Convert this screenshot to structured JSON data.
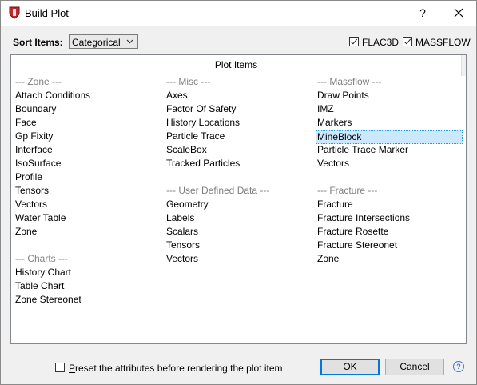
{
  "window": {
    "title": "Build Plot",
    "help_label": "?"
  },
  "sort": {
    "label": "Sort Items:",
    "selected": "Categorical"
  },
  "filters": [
    {
      "label": "FLAC3D",
      "checked": true
    },
    {
      "label": "MASSFLOW",
      "checked": true
    }
  ],
  "list": {
    "header": "Plot Items",
    "columns": [
      {
        "groups": [
          {
            "category": "--- Zone ---",
            "items": [
              "Attach Conditions",
              "Boundary",
              "Face",
              "Gp Fixity",
              "Interface",
              "IsoSurface",
              "Profile",
              "Tensors",
              "Vectors",
              "Water Table",
              "Zone"
            ]
          },
          {
            "category": "--- Charts ---",
            "items": [
              "History Chart",
              "Table Chart",
              "Zone Stereonet"
            ]
          }
        ]
      },
      {
        "groups": [
          {
            "category": "--- Misc ---",
            "items": [
              "Axes",
              "Factor Of Safety",
              "History Locations",
              "Particle Trace",
              "ScaleBox",
              "Tracked Particles"
            ]
          },
          {
            "category": "--- User Defined Data ---",
            "items": [
              "Geometry",
              "Labels",
              "Scalars",
              "Tensors",
              "Vectors"
            ]
          }
        ]
      },
      {
        "groups": [
          {
            "category": "--- Massflow ---",
            "items": [
              "Draw Points",
              "IMZ",
              "Markers",
              "MineBlock",
              "Particle Trace Marker",
              "Vectors"
            ]
          },
          {
            "category": "--- Fracture ---",
            "items": [
              "Fracture",
              "Fracture Intersections",
              "Fracture Rosette",
              "Fracture Stereonet",
              "Zone"
            ]
          }
        ]
      }
    ],
    "selected_item": "MineBlock"
  },
  "preset": {
    "label": "Preset the attributes before rendering the plot item",
    "checked": false
  },
  "buttons": {
    "ok": "OK",
    "cancel": "Cancel"
  },
  "help_icon_label": "?",
  "colors": {
    "accent": "#0078d7",
    "selection": "#cce8ff",
    "category": "#808080",
    "app_icon": "#c0282d"
  }
}
